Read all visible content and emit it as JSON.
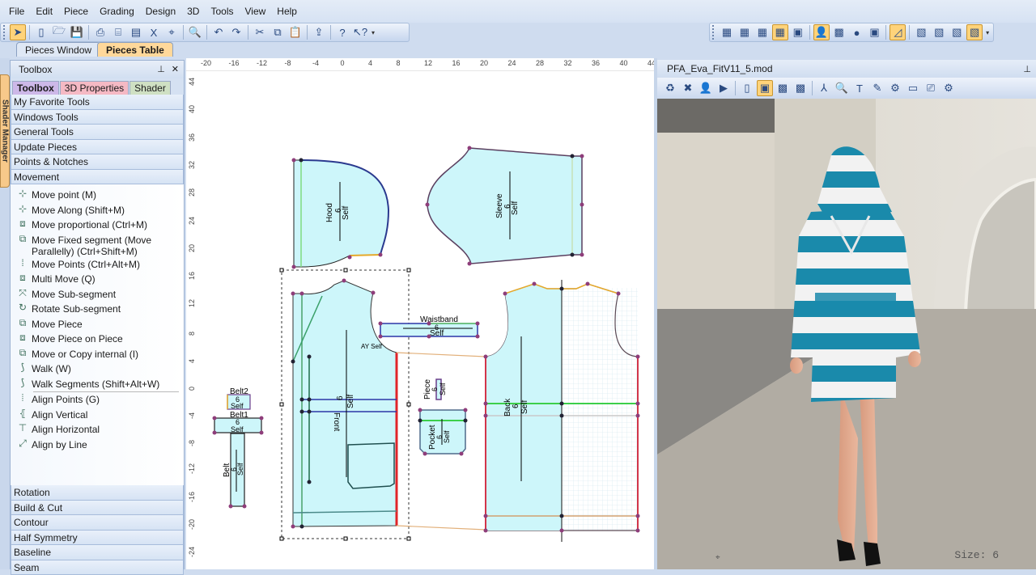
{
  "menu": [
    "File",
    "Edit",
    "Piece",
    "Grading",
    "Design",
    "3D",
    "Tools",
    "View",
    "Help"
  ],
  "main_toolbar": [
    {
      "icon": "pointer-icon",
      "glyph": "➤",
      "active": true
    },
    {
      "icon": "new-file-icon",
      "glyph": "▯"
    },
    {
      "icon": "open-folder-icon",
      "glyph": "🗁"
    },
    {
      "icon": "save-icon",
      "glyph": "💾"
    },
    {
      "icon": "print-icon",
      "glyph": "⎙"
    },
    {
      "icon": "plotter-icon",
      "glyph": "⌸"
    },
    {
      "icon": "layout-icon",
      "glyph": "▤"
    },
    {
      "icon": "excel-icon",
      "glyph": "X"
    },
    {
      "icon": "tag-icon",
      "glyph": "⌖"
    },
    {
      "icon": "zoom-icon",
      "glyph": "🔍"
    },
    {
      "icon": "undo-icon",
      "glyph": "↶"
    },
    {
      "icon": "redo-icon",
      "glyph": "↷"
    },
    {
      "icon": "cut-icon",
      "glyph": "✂"
    },
    {
      "icon": "copy-icon",
      "glyph": "⧉"
    },
    {
      "icon": "paste-icon",
      "glyph": "📋"
    },
    {
      "icon": "export-icon",
      "glyph": "⇪"
    },
    {
      "icon": "help-icon",
      "glyph": "?"
    },
    {
      "icon": "context-help-icon",
      "glyph": "↖?"
    }
  ],
  "right_toolbar": [
    {
      "icon": "pieces-window-icon",
      "glyph": "▦"
    },
    {
      "icon": "table-icon",
      "glyph": "▦"
    },
    {
      "icon": "grid-icon",
      "glyph": "▦"
    },
    {
      "icon": "pieces-table-icon",
      "glyph": "▦",
      "active": true
    },
    {
      "icon": "calculator-icon",
      "glyph": "▣"
    },
    {
      "icon": "avatar-icon",
      "glyph": "👤",
      "active": true
    },
    {
      "icon": "fabric-icon",
      "glyph": "▩"
    },
    {
      "icon": "color-icon",
      "glyph": "●"
    },
    {
      "icon": "frame-icon",
      "glyph": "▣"
    },
    {
      "icon": "ruler-icon",
      "glyph": "◿",
      "active": true
    },
    {
      "icon": "piece-icon-1",
      "glyph": "▧"
    },
    {
      "icon": "piece-icon-2",
      "glyph": "▧"
    },
    {
      "icon": "piece-icon-3",
      "glyph": "▧"
    },
    {
      "icon": "piece-icon-4",
      "glyph": "▧",
      "active": true
    }
  ],
  "doc_tabs": [
    {
      "label": "Pieces Window",
      "selected": false
    },
    {
      "label": "Pieces Table",
      "selected": true
    }
  ],
  "side_tab": "Shader Manager",
  "toolbox": {
    "title": "Toolbox",
    "tabs": [
      "Toolbox",
      "3D Properties",
      "Shader"
    ],
    "sections_top": [
      "My Favorite Tools",
      "Windows Tools",
      "General Tools",
      "Update Pieces",
      "Points & Notches",
      "Movement"
    ],
    "tools": [
      {
        "label": "Move point (M)",
        "glyph": "⊹"
      },
      {
        "label": "Move Along (Shift+M)",
        "glyph": "⊹"
      },
      {
        "label": "Move proportional (Ctrl+M)",
        "glyph": "⧈"
      },
      {
        "label": "Move Fixed segment (Move Parallelly) (Ctrl+Shift+M)",
        "glyph": "⧉"
      },
      {
        "label": "Move Points (Ctrl+Alt+M)",
        "glyph": "⁞"
      },
      {
        "label": "Multi Move (Q)",
        "glyph": "⧈"
      },
      {
        "label": "Move Sub-segment",
        "glyph": "⤧"
      },
      {
        "label": "Rotate Sub-segment",
        "glyph": "↻"
      },
      {
        "label": "Move Piece",
        "glyph": "⧉"
      },
      {
        "label": "Move Piece on Piece",
        "glyph": "⧈"
      },
      {
        "label": "Move or Copy internal (I)",
        "glyph": "⧉"
      },
      {
        "label": "Walk (W)",
        "glyph": "⟆"
      },
      {
        "label": "Walk Segments (Shift+Alt+W)",
        "glyph": "⟆"
      },
      {
        "label": "Align Points (G)",
        "glyph": "⦙"
      },
      {
        "label": "Align Vertical",
        "glyph": "⦃"
      },
      {
        "label": "Align Horizontal",
        "glyph": "⊤"
      },
      {
        "label": "Align by Line",
        "glyph": "⤢"
      }
    ],
    "sections_bottom": [
      "Rotation",
      "Build & Cut",
      "Contour",
      "Half Symmetry",
      "Baseline",
      "Seam"
    ]
  },
  "ruler": {
    "horizontal": [
      "-20",
      "-16",
      "-12",
      "-8",
      "-4",
      "0",
      "4",
      "8",
      "12",
      "16",
      "20",
      "24",
      "28",
      "32",
      "36",
      "40",
      "44"
    ],
    "vertical": [
      "44",
      "40",
      "36",
      "32",
      "28",
      "24",
      "20",
      "16",
      "12",
      "8",
      "4",
      "0",
      "-4",
      "-8",
      "-12",
      "-16",
      "-20",
      "-24"
    ]
  },
  "pieces": {
    "hood": {
      "name": "Hood",
      "size": "6",
      "fabric": "Self"
    },
    "sleeve": {
      "name": "Sleeve",
      "size": "6",
      "fabric": "Self"
    },
    "front": {
      "name": "Front",
      "size": "6",
      "fabric": "Self"
    },
    "waistband": {
      "name": "Waistband",
      "size": "6",
      "fabric": "Self"
    },
    "back": {
      "name": "Back",
      "size": "6",
      "fabric": "Self"
    },
    "piece": {
      "name": "Piece",
      "size": "6",
      "fabric": "Self"
    },
    "pocket": {
      "name": "Pocket",
      "size": "6",
      "fabric": "Self"
    },
    "belt": {
      "name": "Belt",
      "size": "6",
      "fabric": "Self"
    },
    "belt1": {
      "name": "Belt1",
      "size": "6",
      "fabric": "Self"
    },
    "belt2": {
      "name": "Belt2",
      "size": "6",
      "fabric": "Self"
    },
    "annotation": "AY Self"
  },
  "view3d": {
    "title": "PFA_Eva_FitV11_5.mod",
    "toolbar": [
      {
        "icon": "recycle-icon",
        "glyph": "♻"
      },
      {
        "icon": "remove-garment-icon",
        "glyph": "✖"
      },
      {
        "icon": "dress-avatar-icon",
        "glyph": "👤"
      },
      {
        "icon": "play-simulation-icon",
        "glyph": "▶"
      },
      {
        "icon": "frame-icon",
        "glyph": "▯"
      },
      {
        "icon": "frame-selected-icon",
        "glyph": "▣",
        "active": true
      },
      {
        "icon": "texture-icon",
        "glyph": "▩"
      },
      {
        "icon": "fabric-export-icon",
        "glyph": "▩"
      },
      {
        "icon": "axis-icon",
        "glyph": "⅄"
      },
      {
        "icon": "zoom-3d-icon",
        "glyph": "🔍"
      },
      {
        "icon": "text-icon",
        "glyph": "T"
      },
      {
        "icon": "measure-icon",
        "glyph": "✎"
      },
      {
        "icon": "avatar-settings-icon",
        "glyph": "⚙"
      },
      {
        "icon": "display-icon",
        "glyph": "▭"
      },
      {
        "icon": "camera-icon",
        "glyph": "⎚"
      },
      {
        "icon": "avatar-props-icon",
        "glyph": "⚙"
      }
    ],
    "size_label": "Size: 6",
    "stripe_color": "#1a8aab"
  }
}
